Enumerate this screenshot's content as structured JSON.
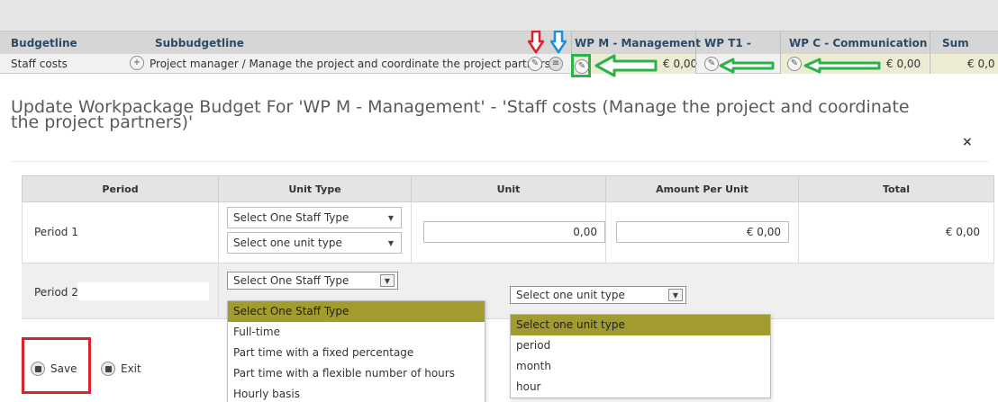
{
  "budget_table": {
    "headers": {
      "budgetline": "Budgetline",
      "subbudgetline": "Subbudgetline",
      "wp_m": "WP M - Management",
      "wp_t1": "WP T1 -",
      "wp_c": "WP C - Communication",
      "sum": "Sum"
    },
    "row": {
      "budgetline": "Staff costs",
      "subbudgetline": "Project manager / Manage the project and coordinate the project partners",
      "wp_m_value": "€ 0,00",
      "wp_c_value": "€ 0,00",
      "sum_value": "€ 0,0"
    }
  },
  "dialog": {
    "title": "Update Workpackage Budget For 'WP M - Management' - 'Staff costs (Manage the project and coordinate the project partners)'",
    "close_symbol": "×"
  },
  "period_table": {
    "headers": {
      "period": "Period",
      "unit_type": "Unit Type",
      "unit": "Unit",
      "amount_per_unit": "Amount Per Unit",
      "total": "Total"
    },
    "rows": [
      {
        "period": "Period 1",
        "staff_type": "Select One Staff Type",
        "unit_type": "Select one unit type",
        "unit": "0,00",
        "amount_per_unit": "€ 0,00",
        "total": "€ 0,00"
      },
      {
        "period": "Period 2",
        "staff_type": "Select One Staff Type",
        "unit_type": "Select one unit type"
      }
    ]
  },
  "staff_type_options": [
    "Select One Staff Type",
    "Full-time",
    "Part time with a fixed percentage",
    "Part time with a flexible number of hours",
    "Hourly basis"
  ],
  "unit_type_options": [
    "Select one unit type",
    "period",
    "month",
    "hour"
  ],
  "buttons": {
    "save": "Save",
    "exit": "Exit"
  },
  "annotation_colors": {
    "red": "#d9232a",
    "blue": "#1a8fe0",
    "green": "#2bb34a",
    "highlight": "#a29c2f"
  }
}
